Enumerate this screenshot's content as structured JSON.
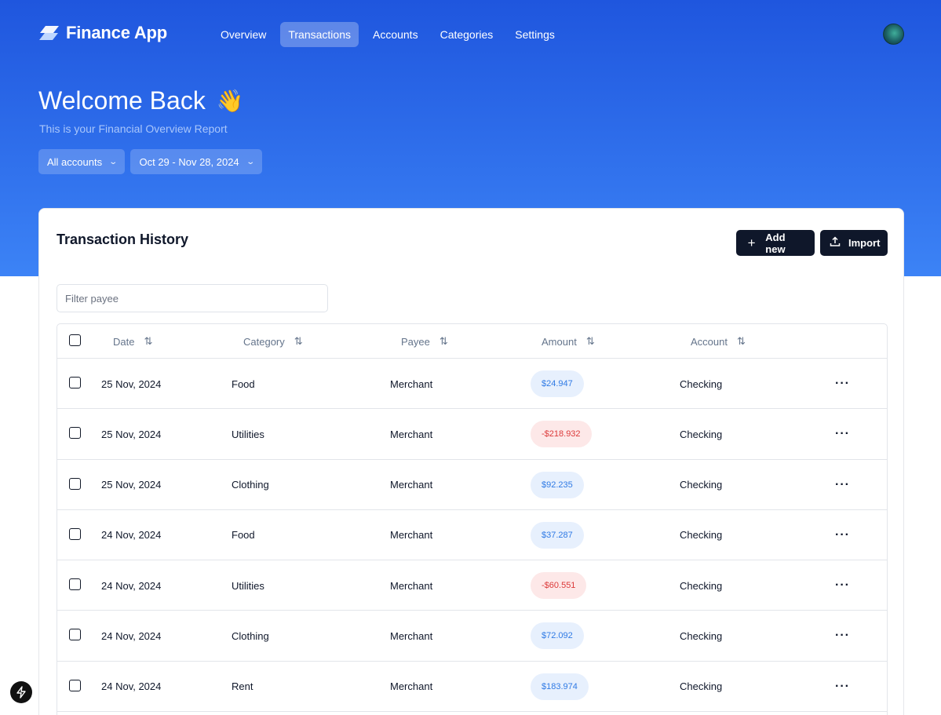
{
  "app": {
    "name": "Finance App"
  },
  "nav": {
    "items": [
      {
        "label": "Overview",
        "active": false
      },
      {
        "label": "Transactions",
        "active": true
      },
      {
        "label": "Accounts",
        "active": false
      },
      {
        "label": "Categories",
        "active": false
      },
      {
        "label": "Settings",
        "active": false
      }
    ]
  },
  "hero": {
    "title": "Welcome Back",
    "emoji": "👋",
    "subtitle": "This is your Financial Overview Report",
    "account_filter": "All accounts",
    "date_filter": "Oct 29 - Nov 28, 2024"
  },
  "card": {
    "title": "Transaction History",
    "add_label": "Add new",
    "import_label": "Import",
    "filter_placeholder": "Filter payee"
  },
  "table": {
    "columns": [
      "Date",
      "Category",
      "Payee",
      "Amount",
      "Account"
    ],
    "rows": [
      {
        "date": "25 Nov, 2024",
        "category": "Food",
        "payee": "Merchant",
        "amount": "$24.947",
        "type": "pos",
        "account": "Checking"
      },
      {
        "date": "25 Nov, 2024",
        "category": "Utilities",
        "payee": "Merchant",
        "amount": "-$218.932",
        "type": "neg",
        "account": "Checking"
      },
      {
        "date": "25 Nov, 2024",
        "category": "Clothing",
        "payee": "Merchant",
        "amount": "$92.235",
        "type": "pos",
        "account": "Checking"
      },
      {
        "date": "24 Nov, 2024",
        "category": "Food",
        "payee": "Merchant",
        "amount": "$37.287",
        "type": "pos",
        "account": "Checking"
      },
      {
        "date": "24 Nov, 2024",
        "category": "Utilities",
        "payee": "Merchant",
        "amount": "-$60.551",
        "type": "neg",
        "account": "Checking"
      },
      {
        "date": "24 Nov, 2024",
        "category": "Clothing",
        "payee": "Merchant",
        "amount": "$72.092",
        "type": "pos",
        "account": "Checking"
      },
      {
        "date": "24 Nov, 2024",
        "category": "Rent",
        "payee": "Merchant",
        "amount": "$183.974",
        "type": "pos",
        "account": "Checking"
      }
    ]
  },
  "colors": {
    "hero_top": "#1f56de",
    "hero_bottom": "#3c83f6",
    "positive": "#2f7ae5",
    "negative": "#dc3a3a",
    "button_dark": "#0f172a"
  },
  "icons": {
    "logo": "stacked-parallelogram-icon",
    "sort": "sort-arrows-icon",
    "add": "plus-icon",
    "import": "upload-icon",
    "row_menu": "more-horizontal-icon",
    "dev_badge": "lightning-icon"
  }
}
